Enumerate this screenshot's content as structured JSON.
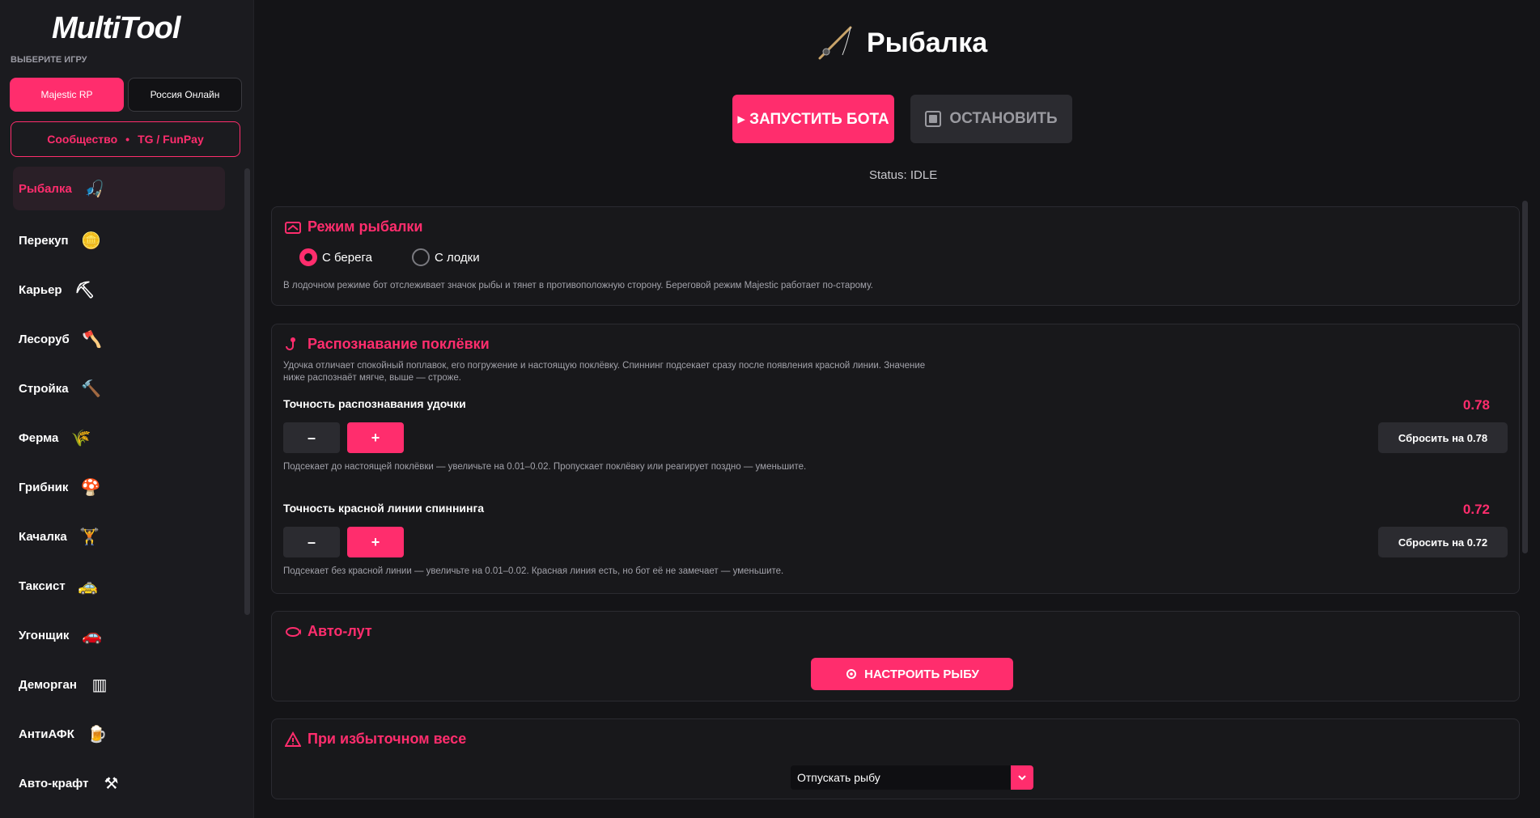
{
  "app": {
    "logo": "MultiTool"
  },
  "sidebar": {
    "choose_label": "ВЫБЕРИТЕ ИГРУ",
    "games": [
      "Majestic RP",
      "Россия Онлайн"
    ],
    "community": {
      "label": "Сообщество",
      "sep": "•",
      "links": "TG / FunPay"
    },
    "items": [
      {
        "label": "Рыбалка",
        "icon": "fishing-rod-icon",
        "glyph": "🎣"
      },
      {
        "label": "Перекуп",
        "icon": "coin-icon",
        "glyph": "🪙"
      },
      {
        "label": "Карьер",
        "icon": "pickaxe-icon",
        "glyph": "⛏"
      },
      {
        "label": "Лесоруб",
        "icon": "axe-icon",
        "glyph": "🪓"
      },
      {
        "label": "Стройка",
        "icon": "hammer-icon",
        "glyph": "🔨"
      },
      {
        "label": "Ферма",
        "icon": "farm-icon",
        "glyph": "🌾"
      },
      {
        "label": "Грибник",
        "icon": "mushroom-icon",
        "glyph": "🍄"
      },
      {
        "label": "Качалка",
        "icon": "dumbbell-icon",
        "glyph": "🏋"
      },
      {
        "label": "Таксист",
        "icon": "taxi-icon",
        "glyph": "🚕"
      },
      {
        "label": "Угонщик",
        "icon": "car-icon",
        "glyph": "🚗"
      },
      {
        "label": "Деморган",
        "icon": "jail-icon",
        "glyph": "▥"
      },
      {
        "label": "АнтиАФК",
        "icon": "beer-icon",
        "glyph": "🍺"
      },
      {
        "label": "Авто-крафт",
        "icon": "anvil-icon",
        "glyph": "⚒"
      }
    ]
  },
  "main": {
    "title": "Рыбалка",
    "start_label": "▸ ЗАПУСТИТЬ БОТА",
    "stop_label": "ОСТАНОВИТЬ",
    "status": "Status: IDLE"
  },
  "mode": {
    "title": "Режим рыбалки",
    "options": [
      "С берега",
      "С лодки"
    ],
    "selected": "С берега",
    "hint": "В лодочном режиме бот отслеживает значок рыбы и тянет в противоположную сторону. Береговой режим Majestic работает по-старому."
  },
  "detect": {
    "title": "Распознавание поклёвки",
    "hint1": "Удочка отличает спокойный поплавок, его погружение и настоящую поклёвку. Спиннинг подсекает сразу после появления красной линии. Значение",
    "hint2": "ниже распознаёт мягче, выше — строже.",
    "rod": {
      "label": "Точность распознавания удочки",
      "value": "0.78",
      "minus": "–",
      "plus": "+",
      "reset": "Сбросить на 0.78",
      "hint": "Подсекает до настоящей поклёвки — увеличьте на 0.01–0.02. Пропускает поклёвку или реагирует поздно — уменьшите."
    },
    "spin": {
      "label": "Точность красной линии спиннинга",
      "value": "0.72",
      "minus": "–",
      "plus": "+",
      "reset": "Сбросить на 0.72",
      "hint": "Подсекает без красной линии — увеличьте на 0.01–0.02. Красная линия есть, но бот её не замечает — уменьшите."
    }
  },
  "autoloot": {
    "title": "Авто-лут",
    "button": "НАСТРОИТЬ РЫБУ"
  },
  "overweight": {
    "title": "При избыточном весе",
    "selected": "Отпускать рыбу"
  },
  "colors": {
    "accent": "#ff2d6d",
    "bg": "#141417",
    "card": "#18181b"
  }
}
